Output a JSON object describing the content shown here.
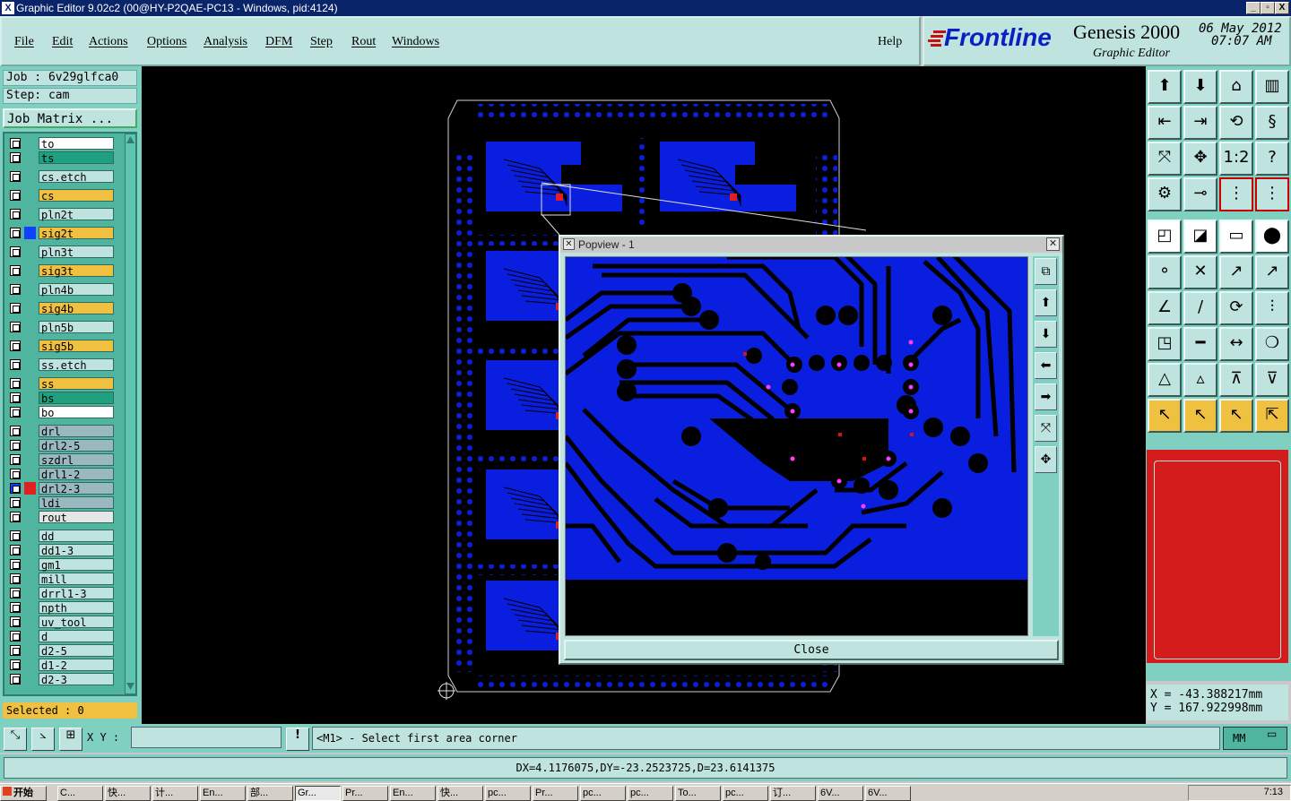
{
  "window": {
    "title": "Graphic Editor 9.02c2 (00@HY-P2QAE-PC13 - Windows, pid:4124)",
    "buttons": [
      "_",
      "▫",
      "X"
    ]
  },
  "menu": {
    "items": [
      "File",
      "Edit",
      "Actions",
      "Options",
      "Analysis",
      "DFM",
      "Step",
      "Rout",
      "Windows"
    ],
    "help": "Help"
  },
  "brand": {
    "logo": "Frontline",
    "product": "Genesis 2000",
    "subtitle": "Graphic Editor",
    "date": "06 May 2012",
    "time": "07:07 AM"
  },
  "job": {
    "job_label": "Job : 6v29glfca0",
    "step_label": "Step: cam",
    "matrix_button": "Job Matrix ..."
  },
  "layers": [
    {
      "name": "to",
      "color": "#ffffff"
    },
    {
      "name": "ts",
      "color": "#20a080"
    },
    {
      "name": "cs.etch",
      "color": "#bfe3df"
    },
    {
      "name": "cs",
      "color": "#f0c040"
    },
    {
      "name": "pln2t",
      "color": "#bfe3df"
    },
    {
      "name": "sig2t",
      "color": "#f0c040",
      "marker": "#1040ff"
    },
    {
      "name": "pln3t",
      "color": "#bfe3df"
    },
    {
      "name": "sig3t",
      "color": "#f0c040"
    },
    {
      "name": "pln4b",
      "color": "#bfe3df"
    },
    {
      "name": "sig4b",
      "color": "#f0c040"
    },
    {
      "name": "pln5b",
      "color": "#bfe3df"
    },
    {
      "name": "sig5b",
      "color": "#f0c040"
    },
    {
      "name": "ss.etch",
      "color": "#bfe3df"
    },
    {
      "name": "ss",
      "color": "#f0c040"
    },
    {
      "name": "bs",
      "color": "#20a080"
    },
    {
      "name": "bo",
      "color": "#ffffff"
    },
    {
      "name": "drl",
      "color": "#9ab8c0"
    },
    {
      "name": "drl2-5",
      "color": "#9ab8c0"
    },
    {
      "name": "szdrl",
      "color": "#9ab8c0"
    },
    {
      "name": "drl1-2",
      "color": "#9ab8c0"
    },
    {
      "name": "drl2-3",
      "color": "#9ab8c0",
      "marker": "#e02020",
      "active": true
    },
    {
      "name": "ldi",
      "color": "#9ab8c0"
    },
    {
      "name": "rout",
      "color": "#e6e6e6"
    },
    {
      "name": "dd",
      "color": "#bfe3df"
    },
    {
      "name": "dd1-3",
      "color": "#bfe3df"
    },
    {
      "name": "gm1",
      "color": "#bfe3df"
    },
    {
      "name": "mill",
      "color": "#bfe3df"
    },
    {
      "name": "drrl1-3",
      "color": "#bfe3df"
    },
    {
      "name": "npth",
      "color": "#bfe3df"
    },
    {
      "name": "uv_tool",
      "color": "#bfe3df"
    },
    {
      "name": "d",
      "color": "#bfe3df"
    },
    {
      "name": "d2-5",
      "color": "#bfe3df"
    },
    {
      "name": "d1-2",
      "color": "#bfe3df"
    },
    {
      "name": "d2-3",
      "color": "#bfe3df"
    }
  ],
  "selected": "Selected : 0",
  "popview": {
    "title": "Popview - 1",
    "close_label": "Close"
  },
  "coords": {
    "x": "X  = -43.388217mm",
    "y": "Y  = 167.922998mm"
  },
  "command": {
    "xy_label": "X Y :",
    "xy_value": "",
    "prompt": "<M1> - Select first area corner",
    "units": "MM"
  },
  "status": "DX=4.1176075,DY=-23.2523725,D=23.6141375",
  "taskbar": {
    "start": "开始",
    "tasks": [
      "C...",
      "快...",
      "计...",
      "En...",
      "部...",
      "Gr...",
      "Pr...",
      "En...",
      "快...",
      "pc...",
      "Pr...",
      "pc...",
      "pc...",
      "To...",
      "pc...",
      "订...",
      "6V...",
      "6V..."
    ],
    "clock": "7:13"
  },
  "colors": {
    "board": "#0a1ee0",
    "panel": "#7fd0c0",
    "field": "#bfe3df",
    "highlight": "#f0c040"
  }
}
